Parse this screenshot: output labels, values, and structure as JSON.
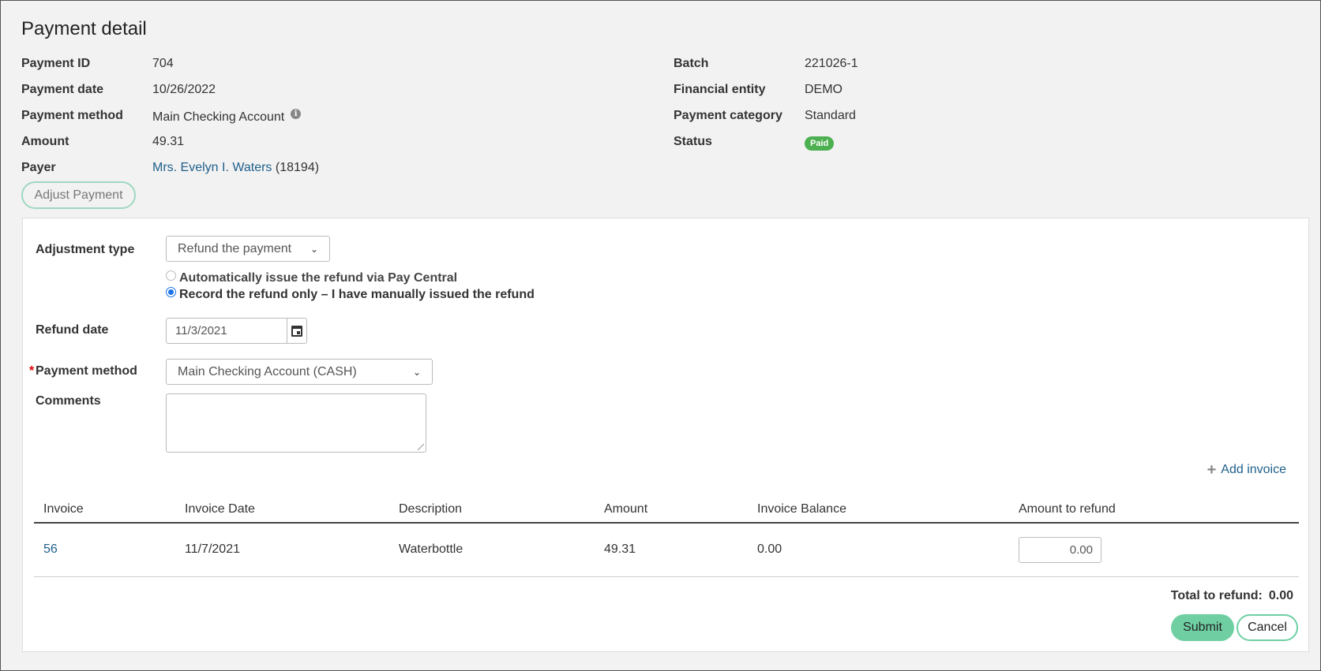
{
  "page": {
    "title": "Payment detail"
  },
  "details_left": [
    {
      "label": "Payment ID",
      "value": "704"
    },
    {
      "label": "Payment date",
      "value": "10/26/2022"
    },
    {
      "label": "Payment method",
      "value": "Main Checking Account"
    },
    {
      "label": "Amount",
      "value": "49.31"
    },
    {
      "label": "Payer",
      "value": "Mrs. Evelyn I. Waters",
      "suffix": "(18194)"
    }
  ],
  "details_right": [
    {
      "label": "Batch",
      "value": "221026-1"
    },
    {
      "label": "Financial entity",
      "value": "DEMO"
    },
    {
      "label": "Payment category",
      "value": "Standard"
    },
    {
      "label": "Status",
      "value": "Paid"
    }
  ],
  "info_icon_glyph": "i",
  "adjust_button": "Adjust Payment",
  "form": {
    "adjustment_type_label": "Adjustment type",
    "adjustment_type_value": "Refund the payment",
    "radio_auto": "Automatically issue the refund via Pay Central",
    "radio_manual": "Record the refund only – I have manually issued the refund",
    "refund_date_label": "Refund date",
    "refund_date_value": "11/3/2021",
    "required_marker": "*",
    "payment_method_label": "Payment method",
    "payment_method_value": "Main Checking Account (CASH)",
    "comments_label": "Comments"
  },
  "add_invoice": "Add invoice",
  "table": {
    "headers": [
      "Invoice",
      "Invoice Date",
      "Description",
      "Amount",
      "Invoice Balance",
      "Amount to refund"
    ],
    "rows": [
      {
        "invoice": "56",
        "date": "11/7/2021",
        "description": "Waterbottle",
        "amount": "49.31",
        "balance": "0.00",
        "refund": "0.00"
      }
    ]
  },
  "total_label": "Total to refund:",
  "total_value": "0.00",
  "submit": "Submit",
  "cancel": "Cancel",
  "colors": {
    "accent": "#6fcfa3",
    "link": "#1f5f8b",
    "paid_badge": "#4caf50"
  }
}
